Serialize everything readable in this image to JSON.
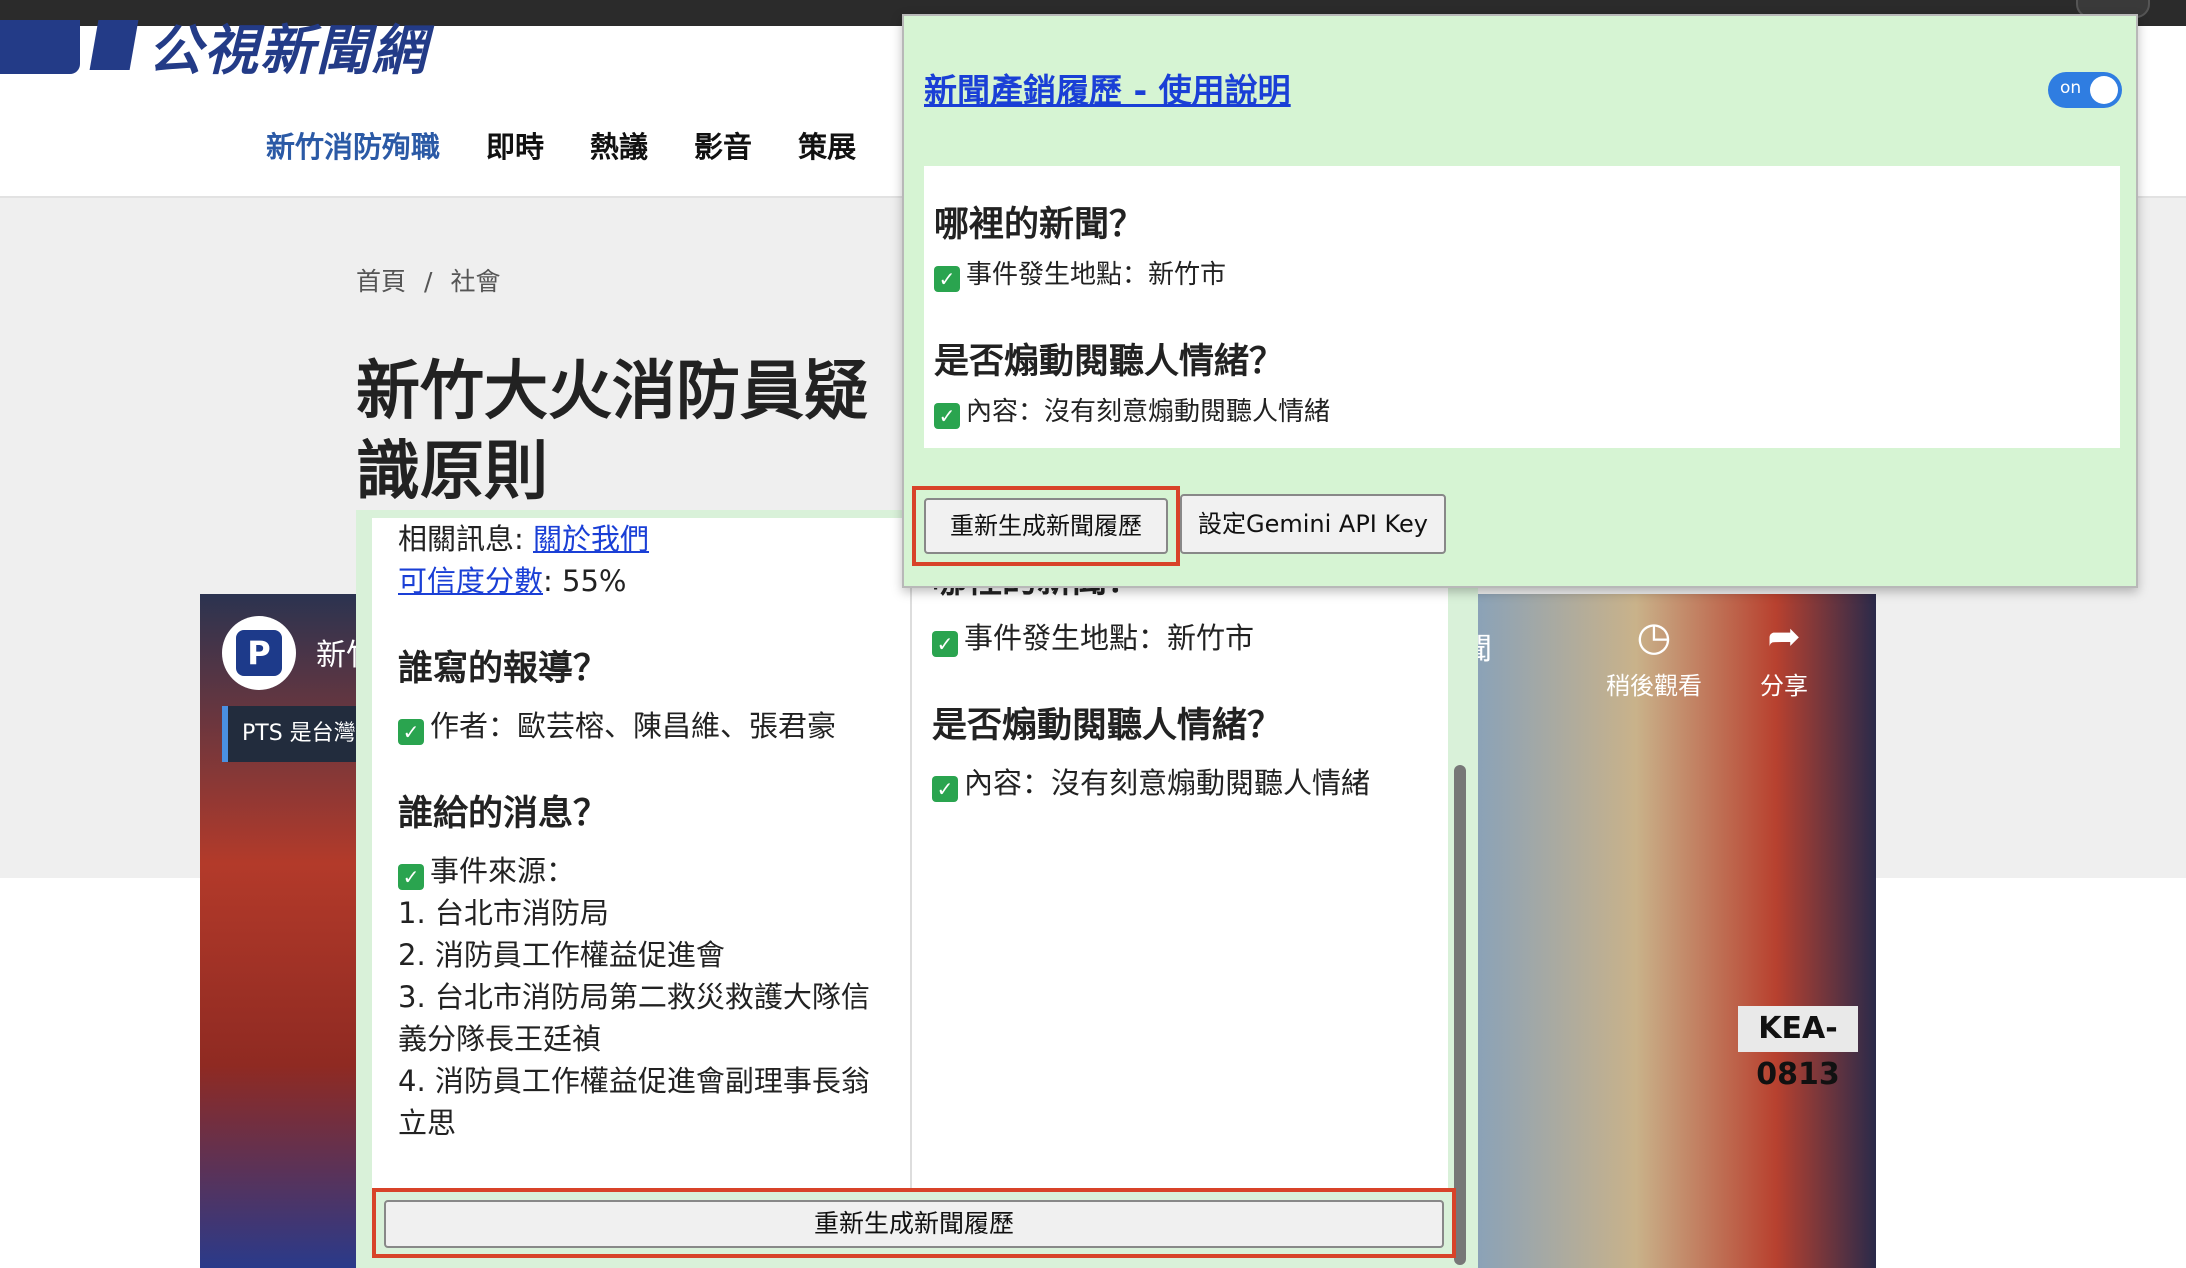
{
  "site": {
    "logo_text": "公視新聞網",
    "nav": [
      "新竹消防殉職",
      "即時",
      "熱議",
      "影音",
      "策展"
    ],
    "breadcrumb": [
      "首頁",
      "社會"
    ],
    "breadcrumb_sep": "/",
    "headline_lines": [
      "新竹大火消防員疑",
      "識原則"
    ]
  },
  "video": {
    "channel_logo": "P",
    "channel_title": "新竹",
    "subtitle": "PTS 是台灣的",
    "overlay_text": "聞",
    "watch_later_icon": "clock-icon",
    "watch_later_label": "稍後觀看",
    "share_icon": "share-arrow-icon",
    "share_label": "分享",
    "plate": "KEA-0813"
  },
  "inline_panel": {
    "related_label": "相關訊息: ",
    "related_link": "關於我們",
    "credibility_link": "可信度分數",
    "credibility_value": ": 55%",
    "who_wrote_heading": "誰寫的報導？",
    "author_line": "作者：歐芸榕、陳昌維、張君豪",
    "who_gave_heading": "誰給的消息？",
    "source_label": "事件來源：",
    "sources": [
      "1. 台北市消防局",
      "2. 消防員工作權益促進會",
      "3. 台北市消防局第二救災救護大隊信",
      "義分隊長王廷禎",
      "4. 消防員工作權益促進會副理事長翁",
      "立思"
    ],
    "where_heading_partial": "哪裡的新聞？",
    "location_line": "事件發生地點：新竹市",
    "emotion_heading": "是否煽動閱聽人情緒？",
    "emotion_line": "內容：沒有刻意煽動閱聽人情緒",
    "regenerate_button": "重新生成新聞履歷"
  },
  "popup": {
    "title": "新聞產銷履歷 - 使用說明",
    "toggle_label": "on",
    "toggle_on": true,
    "where_heading": "哪裡的新聞？",
    "location_line": "事件發生地點：新竹市",
    "emotion_heading": "是否煽動閱聽人情緒？",
    "emotion_line": "內容：沒有刻意煽動閱聽人情緒",
    "regenerate_button": "重新生成新聞履歷",
    "api_key_button": "設定Gemini API Key"
  },
  "icons": {
    "check": "check-icon"
  },
  "colors": {
    "panel_bg": "#d6f4d3",
    "link": "#1a3fd6",
    "highlight_border": "#d84329",
    "nav_active": "#2b5aa6",
    "check_green": "#2aa44f",
    "toggle_blue": "#2f7de1"
  }
}
